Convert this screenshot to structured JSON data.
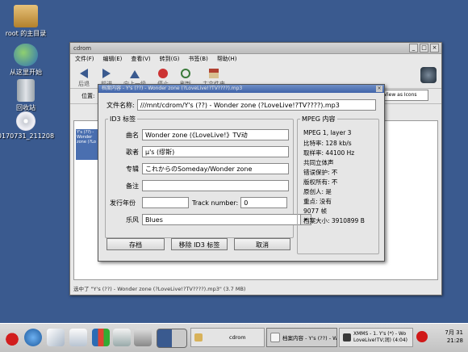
{
  "desktop": {
    "icons": [
      {
        "label": "root 的主目录",
        "icon": "home-folder-icon"
      },
      {
        "label": "从这里开始",
        "icon": "start-here-icon"
      },
      {
        "label": "回收站",
        "icon": "trash-icon"
      },
      {
        "label": "0170731_211208",
        "icon": "cdrom-icon"
      }
    ]
  },
  "file_window": {
    "title": "cdrom",
    "menu": [
      "文件(F)",
      "编辑(E)",
      "查看(V)",
      "转到(G)",
      "书签(B)",
      "帮助(H)"
    ],
    "toolbar": [
      "后退",
      "前进",
      "向上一级",
      "停止",
      "刷新",
      "主文件夹"
    ],
    "location_label": "位置:",
    "view_mode": "View as Icons",
    "selected_item_label": "Y's (??) - Wonder zone (?Lo",
    "status": "选中了 \"Y's (??) - Wonder zone (?LoveLive!?TV????).mp3\" (3.7 MB)"
  },
  "dialog": {
    "title": "档案内容 - Y's (??) - Wonder zone (?LoveLive!?TV????).mp3",
    "filename_label": "文件名称:",
    "filename": "///mnt/cdrom/Y's (??) - Wonder zone (?LoveLive!?TV????).mp3",
    "id3_group": "ID3 标签",
    "fields": {
      "title_label": "曲名",
      "title": "Wonder zone (《LoveLive!》TV动",
      "artist_label": "歌者",
      "artist": "μ's (缪斯)",
      "album_label": "专辑",
      "album": "これからのSomeday/Wonder zone",
      "comment_label": "备注",
      "comment": "",
      "year_label": "发行年份",
      "year": "",
      "track_label": "Track number:",
      "track": "0",
      "genre_label": "乐风",
      "genre": "Blues"
    },
    "mpeg_group": "MPEG 内容",
    "mpeg": [
      "MPEG 1, layer 3",
      "比特率: 128 kb/s",
      "取样率: 44100 Hz",
      "共同立体声",
      "错误保护: 不",
      "版权所有: 不",
      "原创人: 是",
      "重点: 没有",
      "9077 帧",
      "档案大小: 3910899 B"
    ],
    "buttons": {
      "save": "存档",
      "remove": "移除 ID3 标签",
      "cancel": "取消"
    }
  },
  "taskbar": {
    "tasks": [
      {
        "label": "cdrom"
      },
      {
        "label": "档案内容 - Y's (??) - W"
      },
      {
        "label": "XMMS - 1. Y's (*) - Wo LoveLive!TV;润) (4:04)"
      }
    ],
    "clock": {
      "date": "7月 31",
      "time": "21:28"
    }
  }
}
